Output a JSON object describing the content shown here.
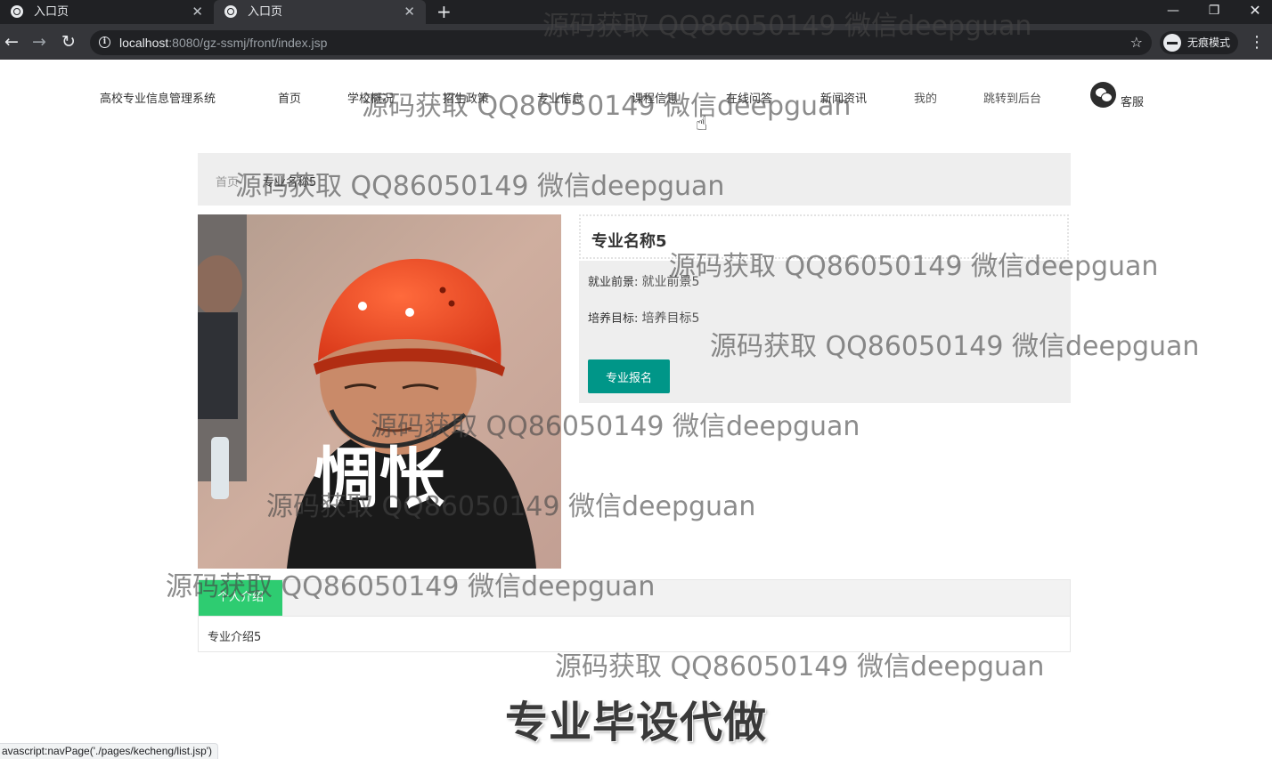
{
  "browser": {
    "tabs": [
      {
        "title": "入口页",
        "active": false
      },
      {
        "title": "入口页",
        "active": true
      }
    ],
    "new_tab": "+",
    "url_host": "localhost",
    "url_rest": ":8080/gz-ssmj/front/index.jsp",
    "incognito_label": "无痕模式",
    "status_url": "avascript:navPage('./pages/kecheng/list.jsp')"
  },
  "nav": {
    "site_title": "高校专业信息管理系统",
    "items": [
      "首页",
      "学校概况",
      "招生政策",
      "专业信息",
      "课程信息",
      "在线问答",
      "新闻资讯",
      "我的",
      "跳转到后台"
    ],
    "service_label": "客服"
  },
  "breadcrumb": {
    "home": "首页",
    "separator": "/",
    "current": "专业名称5"
  },
  "photo": {
    "caption": "惆怅"
  },
  "detail": {
    "title": "专业名称5",
    "prospect_label": "就业前景:",
    "prospect_value": "就业前景5",
    "goal_label": "培养目标:",
    "goal_value": "培养目标5",
    "enroll_button": "专业报名"
  },
  "intro": {
    "tab_label": "个人介绍",
    "text": "专业介绍5"
  },
  "promo_text": "专业毕设代做",
  "watermark_text": "源码获取 QQ86050149 微信deepguan",
  "colors": {
    "accent_teal": "#009688",
    "accent_green": "#2ecc71",
    "panel_gray": "#eeeeee",
    "chrome_dark": "#202124"
  }
}
